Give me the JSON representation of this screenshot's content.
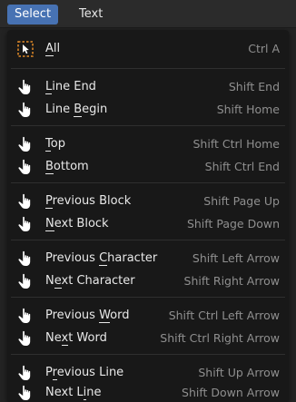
{
  "menubar": {
    "tabs": [
      {
        "label": "Select",
        "active": true
      },
      {
        "label": "Text",
        "active": false
      }
    ]
  },
  "menu": {
    "items": [
      {
        "label": "All",
        "underline": 0,
        "shortcut": "Ctrl A",
        "icon": "select-box-icon"
      },
      {
        "label": "Line End",
        "underline": 0,
        "shortcut": "Shift End",
        "icon": "hand-pointer-icon"
      },
      {
        "label": "Line Begin",
        "underline": 5,
        "shortcut": "Shift Home",
        "icon": "hand-pointer-icon"
      },
      {
        "label": "Top",
        "underline": 0,
        "shortcut": "Shift Ctrl Home",
        "icon": "hand-pointer-icon"
      },
      {
        "label": "Bottom",
        "underline": 0,
        "shortcut": "Shift Ctrl End",
        "icon": "hand-pointer-icon"
      },
      {
        "label": "Previous Block",
        "underline": 0,
        "shortcut": "Shift Page Up",
        "icon": "hand-pointer-icon"
      },
      {
        "label": "Next Block",
        "underline": 0,
        "shortcut": "Shift Page Down",
        "icon": "hand-pointer-icon"
      },
      {
        "label": "Previous Character",
        "underline": 9,
        "shortcut": "Shift Left Arrow",
        "icon": "hand-pointer-icon"
      },
      {
        "label": "Next Character",
        "underline": 1,
        "shortcut": "Shift Right Arrow",
        "icon": "hand-pointer-icon"
      },
      {
        "label": "Previous Word",
        "underline": 9,
        "shortcut": "Shift Ctrl Left Arrow",
        "icon": "hand-pointer-icon"
      },
      {
        "label": "Next Word",
        "underline": 2,
        "shortcut": "Shift Ctrl Right Arrow",
        "icon": "hand-pointer-icon"
      },
      {
        "label": "Previous Line",
        "underline": 1,
        "shortcut": "Shift Up Arrow",
        "icon": "hand-pointer-icon"
      },
      {
        "label": "Next Line",
        "underline": 6,
        "shortcut": "Shift Down Arrow",
        "icon": "hand-pointer-icon"
      }
    ]
  },
  "colors": {
    "accent": "#4772b3",
    "menu_background": "#181818",
    "separator": "#2f2f2f",
    "label_text": "#e8e8e8",
    "shortcut_text": "#8f8f8f",
    "select_box_orange": "#e38a29"
  }
}
